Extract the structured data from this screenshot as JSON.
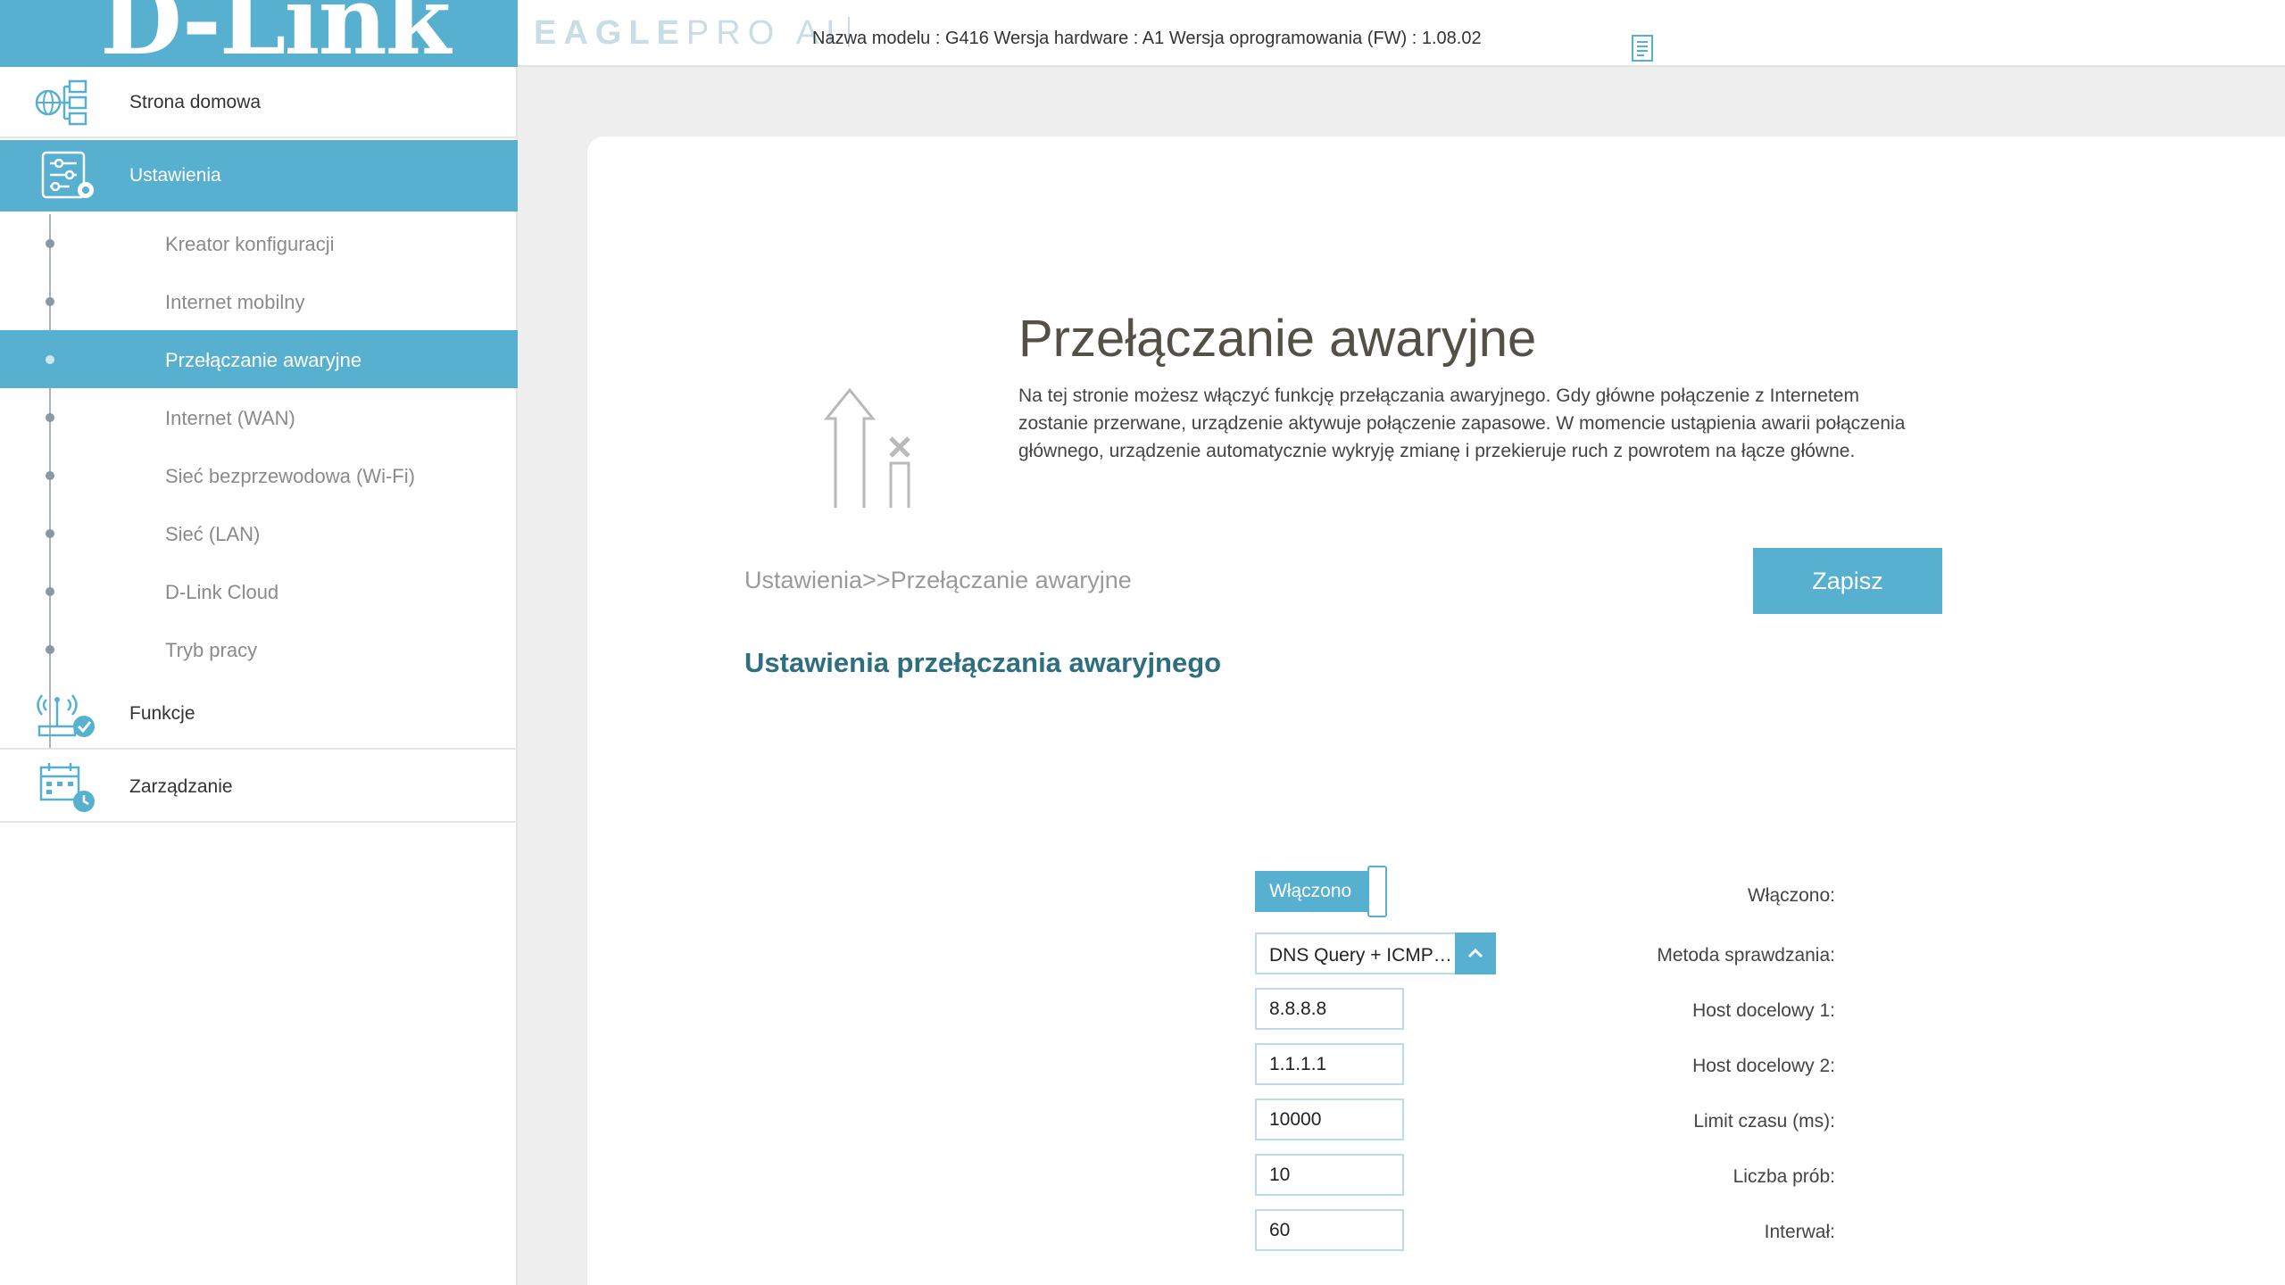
{
  "header": {
    "brand": "D-Link",
    "brand_reg": "®",
    "product_bold": "EAGLE",
    "product_light": "PRO AI",
    "model_info": "Nazwa modelu : G416 Wersja hardware : A1 Wersja oprogramowania (FW) : 1.08.02",
    "doc_icon": "document-icon"
  },
  "sidebar": {
    "home": {
      "label": "Strona domowa",
      "icon": "home-network-icon"
    },
    "settings": {
      "label": "Ustawienia",
      "icon": "settings-sliders-icon"
    },
    "sub_items": [
      {
        "label": "Kreator konfiguracji"
      },
      {
        "label": "Internet mobilny"
      },
      {
        "label": "Przełączanie awaryjne"
      },
      {
        "label": "Internet (WAN)"
      },
      {
        "label": "Sieć bezprzewodowa (Wi-Fi)"
      },
      {
        "label": "Sieć (LAN)"
      },
      {
        "label": "D-Link Cloud"
      },
      {
        "label": "Tryb pracy"
      }
    ],
    "features": {
      "label": "Funkcje",
      "icon": "router-check-icon"
    },
    "management": {
      "label": "Zarządzanie",
      "icon": "calendar-clock-icon"
    }
  },
  "main": {
    "title": "Przełączanie awaryjne",
    "description": "Na tej stronie możesz włączyć funkcję przełączania awaryjnego. Gdy główne połączenie z Internetem zostanie przerwane, urządzenie aktywuje połączenie zapasowe. W momencie ustąpienia awarii połączenia głównego, urządzenie automatycznie wykryję zmianę i przekieruje ruch z powrotem na łącze główne.",
    "breadcrumb": "Ustawienia>>Przełączanie awaryjne",
    "save_label": "Zapisz",
    "section_title": "Ustawienia przełączania awaryjnego",
    "fields": {
      "enabled": {
        "label": "Włączono:",
        "value": "Włączono"
      },
      "method": {
        "label": "Metoda sprawdzania:",
        "value": "DNS Query + ICMP…"
      },
      "host1": {
        "label": "Host docelowy 1:",
        "value": "8.8.8.8"
      },
      "host2": {
        "label": "Host docelowy 2:",
        "value": "1.1.1.1"
      },
      "timeout": {
        "label": "Limit czasu (ms):",
        "value": "10000"
      },
      "retries": {
        "label": "Liczba prób:",
        "value": "10"
      },
      "interval": {
        "label": "Interwał:",
        "value": "60"
      }
    }
  },
  "colors": {
    "accent": "#57b0d0",
    "section_title": "#2d6f7f"
  }
}
